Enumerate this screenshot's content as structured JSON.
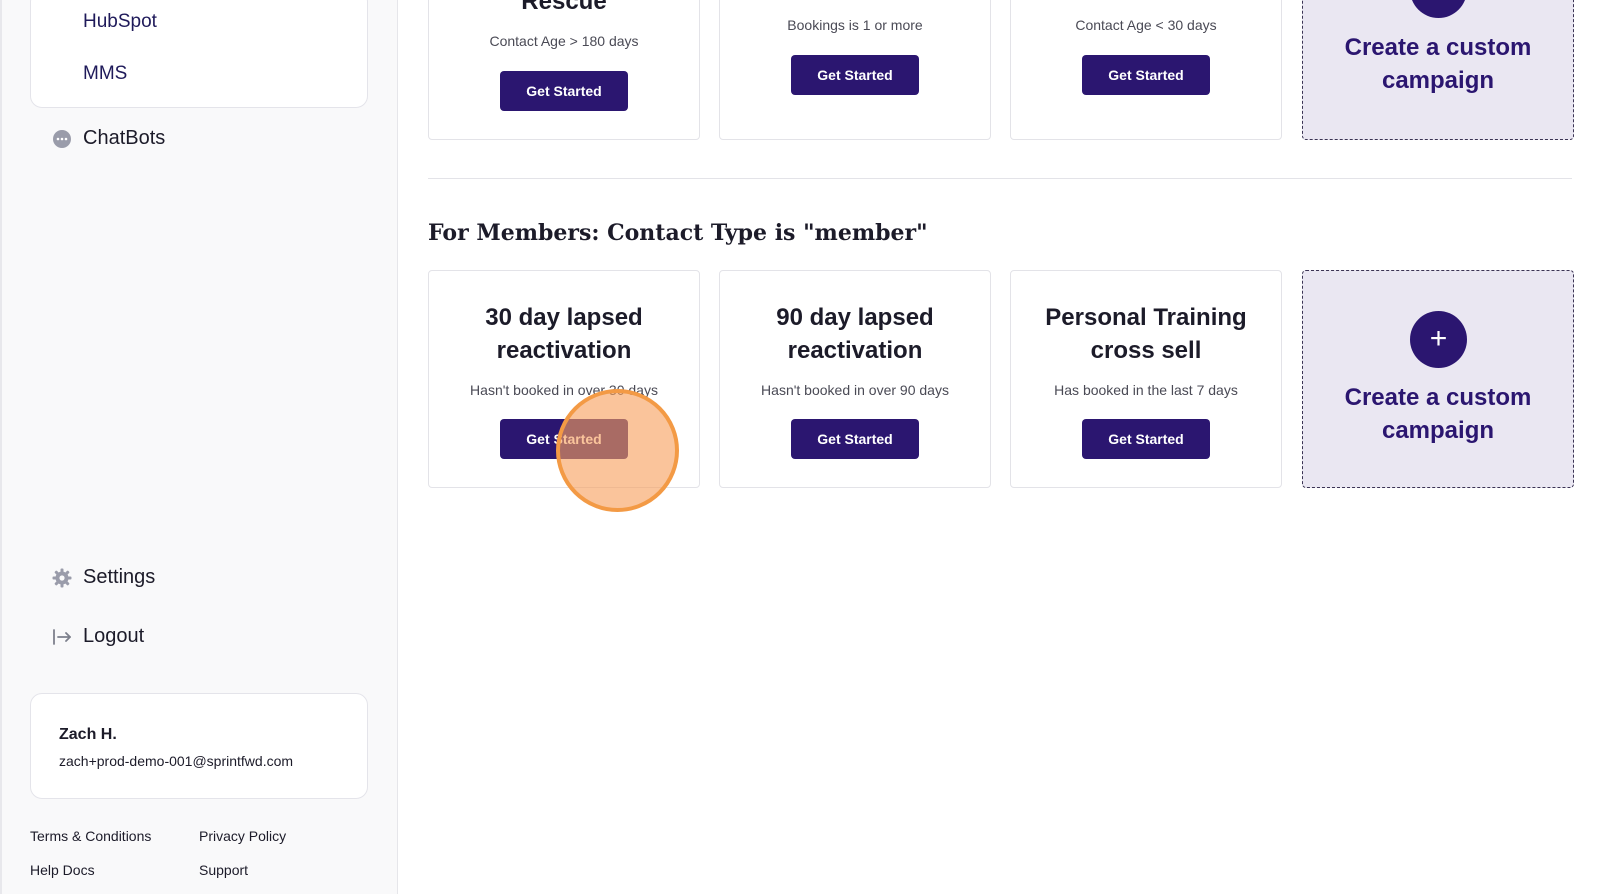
{
  "sidebar": {
    "sub_items": [
      "HubSpot",
      "MMS"
    ],
    "chatbots": "ChatBots",
    "settings": "Settings",
    "logout": "Logout",
    "user": {
      "name": "Zach H.",
      "email": "zach+prod-demo-001@sprintfwd.com"
    },
    "footer": {
      "terms": "Terms & Conditions",
      "privacy": "Privacy Policy",
      "help": "Help Docs",
      "support": "Support"
    }
  },
  "top_row": {
    "cards": [
      {
        "title": "Rescue",
        "condition": "Contact Age > 180 days",
        "button": "Get Started"
      },
      {
        "condition": "Bookings is 1 or more",
        "button": "Get Started"
      },
      {
        "condition": "Contact Age < 30 days",
        "button": "Get Started"
      }
    ],
    "custom": {
      "title": "Create a custom campaign"
    }
  },
  "members_section": {
    "heading": "For Members: Contact Type is \"member\"",
    "cards": [
      {
        "title": "30 day lapsed reactivation",
        "condition": "Hasn't booked in over 30 days",
        "button": "Get Started"
      },
      {
        "title": "90 day lapsed reactivation",
        "condition": "Hasn't booked in over 90 days",
        "button": "Get Started"
      },
      {
        "title": "Personal Training cross sell",
        "condition": "Has booked in the last 7 days",
        "button": "Get Started"
      }
    ],
    "custom": {
      "plus": "+",
      "title": "Create a custom campaign"
    }
  },
  "colors": {
    "accent": "#2b1670",
    "custom_bg": "#eae7f2",
    "click_indicator": "#f39a45"
  },
  "icons": {
    "chatbots": "chat-bubble-icon",
    "settings": "gear-icon",
    "logout": "logout-arrow-icon",
    "add": "plus-icon"
  }
}
